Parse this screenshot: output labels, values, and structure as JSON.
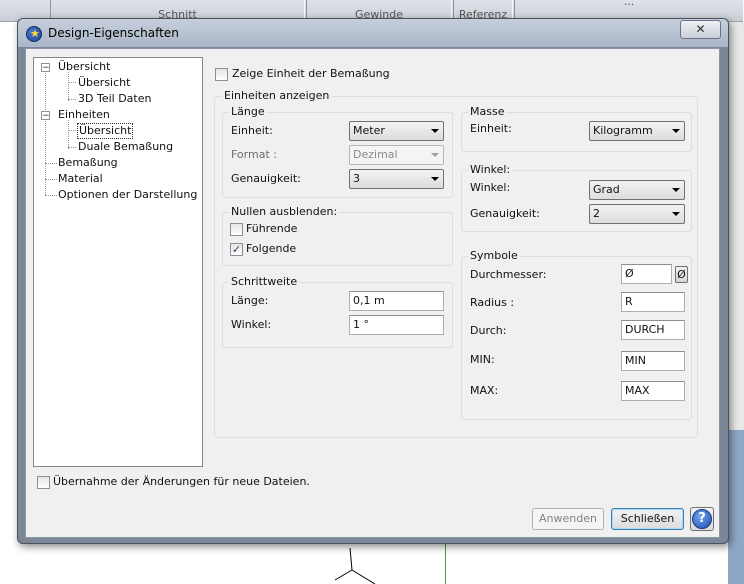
{
  "background": {
    "tabs": [
      "Schnitt",
      "Gewinde",
      "Referenz",
      "..."
    ]
  },
  "dialog": {
    "title": "Design-Eigenschaften",
    "close_glyph": "✕"
  },
  "tree": {
    "items": [
      {
        "label": "Übersicht",
        "expander": "−"
      },
      {
        "label": "Übersicht"
      },
      {
        "label": "3D Teil Daten"
      },
      {
        "label": "Einheiten",
        "expander": "−"
      },
      {
        "label": "Übersicht"
      },
      {
        "label": "Duale Bemaßung"
      },
      {
        "label": "Bemaßung"
      },
      {
        "label": "Material"
      },
      {
        "label": "Optionen der Darstellung"
      }
    ]
  },
  "show_unit": {
    "label": "Zeige Einheit der Bemaßung",
    "checked": false
  },
  "units_group": {
    "label": "Einheiten anzeigen"
  },
  "length": {
    "label": "Länge",
    "unit_label": "Einheit:",
    "unit_value": "Meter",
    "format_label": "Format :",
    "format_value": "Dezimal",
    "precision_label": "Genauigkeit:",
    "precision_value": "3"
  },
  "zeros": {
    "label": "Nullen ausblenden:",
    "leading_label": "Führende",
    "leading_checked": false,
    "trailing_label": "Folgende",
    "trailing_checked": true,
    "check_glyph": "✓"
  },
  "step": {
    "label": "Schrittweite",
    "length_label": "Länge:",
    "length_value": "0,1 m",
    "angle_label": "Winkel:",
    "angle_value": "1 °"
  },
  "mass": {
    "label": "Masse",
    "unit_label": "Einheit:",
    "unit_value": "Kilogramm"
  },
  "angle": {
    "label": "Winkel:",
    "angle_label": "Winkel:",
    "angle_value": "Grad",
    "precision_label": "Genauigkeit:",
    "precision_value": "2"
  },
  "symbols": {
    "label": "Symbole",
    "diameter_label": "Durchmesser:",
    "diameter_value": "Ø",
    "diameter_button": "Ø",
    "radius_label": "Radius :",
    "radius_value": "R",
    "through_label": "Durch:",
    "through_value": "DURCH",
    "min_label": "MIN:",
    "min_value": "MIN",
    "max_label": "MAX:",
    "max_value": "MAX"
  },
  "apply_new": {
    "label": "Übernahme der Änderungen für neue Dateien.",
    "checked": false
  },
  "buttons": {
    "apply": "Anwenden",
    "close": "Schließen",
    "help": "?"
  }
}
